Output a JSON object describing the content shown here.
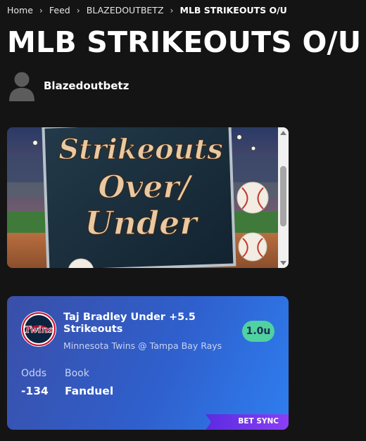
{
  "breadcrumb": {
    "items": [
      {
        "label": "Home"
      },
      {
        "label": "Feed"
      },
      {
        "label": "BLAZEDOUTBETZ"
      }
    ],
    "current": "MLB STRIKEOUTS O/U"
  },
  "page": {
    "title": "MLB STRIKEOUTS O/U"
  },
  "author": {
    "name": "Blazedoutbetz",
    "avatar_icon": "user-silhouette-icon"
  },
  "image": {
    "sign_text_line1": "Strikeouts",
    "sign_text_line2": "Over/",
    "sign_text_line3": "Under"
  },
  "pick": {
    "title": "Taj Bradley Under +5.5 Strikeouts",
    "matchup": "Minnesota Twins @ Tampa Bay Rays",
    "units": "1.0u",
    "odds_label": "Odds",
    "odds_value": "-134",
    "book_label": "Book",
    "book_value": "Fanduel",
    "team_logo_text": "Twins",
    "badge": "BET SYNC"
  },
  "colors": {
    "background": "#141414",
    "card_gradient_start": "#3a4fa8",
    "card_gradient_end": "#2f7ef0",
    "units_pill": "#4fd1a0",
    "bet_sync_purple": "#7b2ff7"
  }
}
